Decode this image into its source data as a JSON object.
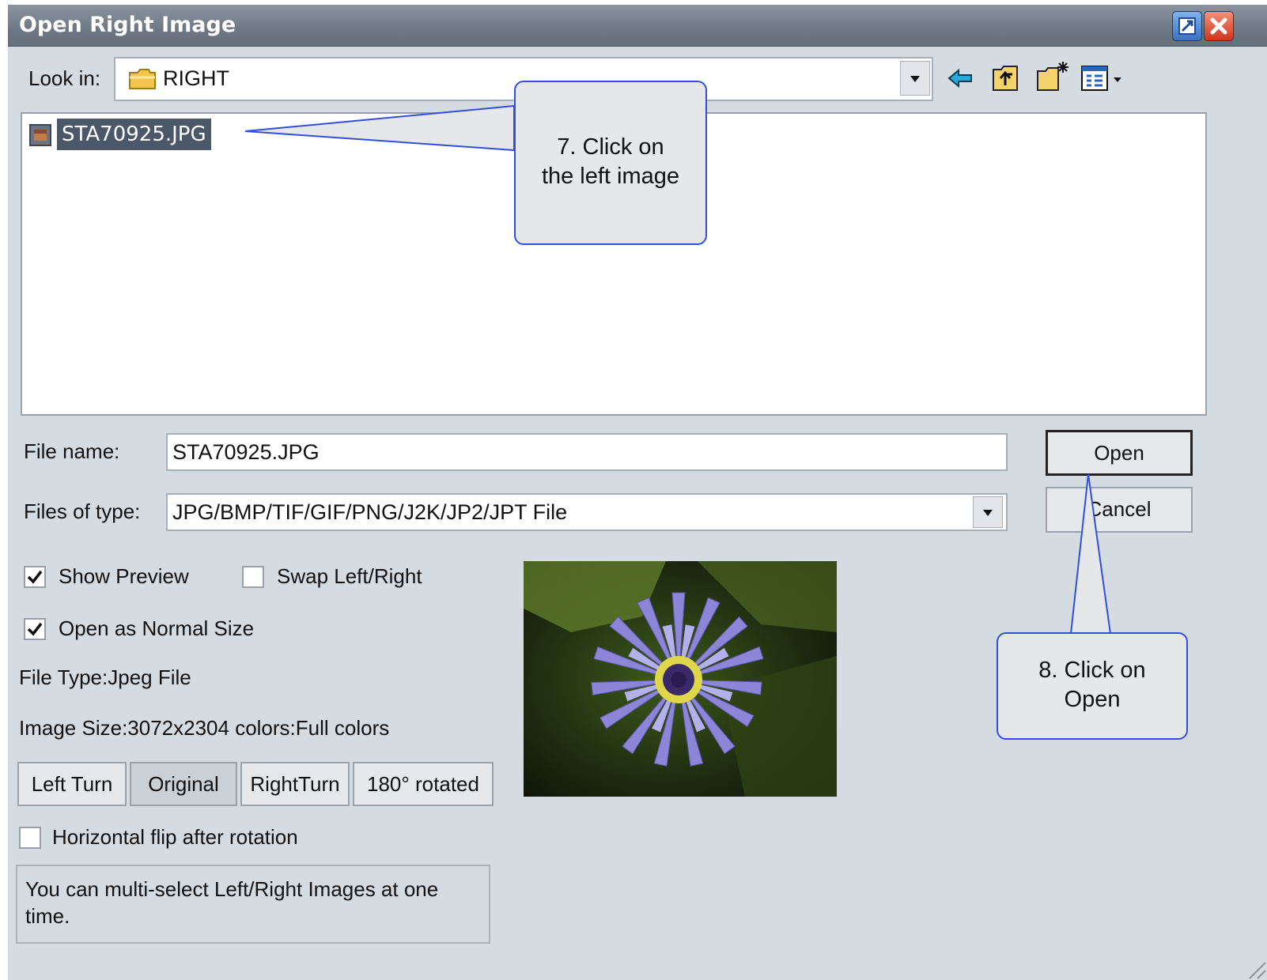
{
  "window": {
    "title": "Open Right Image"
  },
  "lookin": {
    "label": "Look in:",
    "value": "RIGHT"
  },
  "files": [
    {
      "name": "STA70925.JPG"
    }
  ],
  "filename": {
    "label": "File name:",
    "value": "STA70925.JPG"
  },
  "filetype": {
    "label": "Files of type:",
    "value": "JPG/BMP/TIF/GIF/PNG/J2K/JP2/JPT File"
  },
  "buttons": {
    "open": "Open",
    "cancel": "Cancel"
  },
  "options": {
    "show_preview": {
      "label": "Show Preview",
      "checked": true
    },
    "swap": {
      "label": "Swap Left/Right",
      "checked": false
    },
    "normal_size": {
      "label": "Open as Normal Size",
      "checked": true
    },
    "hflip": {
      "label": "Horizontal flip after rotation",
      "checked": false
    }
  },
  "info": {
    "file_type": "File Type:Jpeg File",
    "image_size": "Image Size:3072x2304  colors:Full colors"
  },
  "rotation": {
    "left": "Left Turn",
    "original": "Original",
    "right": "RightTurn",
    "r180": "180° rotated"
  },
  "note": "You can multi-select Left/Right Images at one time.",
  "callouts": {
    "step7_line1": "7. Click on",
    "step7_line2": "the left image",
    "step8_line1": "8. Click on",
    "step8_line2": "Open"
  },
  "colors": {
    "callout_border": "#2f4fdc",
    "selection": "#4a5869",
    "title_bar": "#6e7884"
  },
  "icons": [
    "folder-icon",
    "back-arrow-icon",
    "up-folder-icon",
    "new-folder-icon",
    "view-menu-icon",
    "maximize-icon",
    "close-icon",
    "jpg-file-icon"
  ]
}
